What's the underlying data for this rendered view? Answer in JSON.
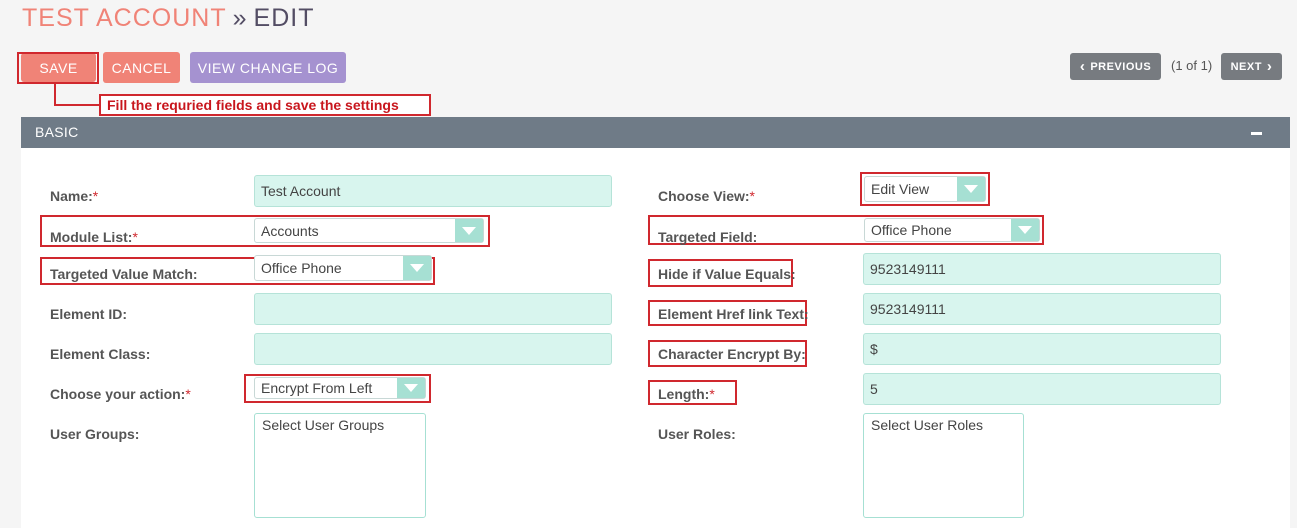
{
  "title": {
    "module": "TEST ACCOUNT",
    "separator": "»",
    "action": "EDIT"
  },
  "buttons": {
    "save": "SAVE",
    "cancel": "CANCEL",
    "view_change_log": "VIEW CHANGE LOG"
  },
  "pagination": {
    "previous": "PREVIOUS",
    "count": "(1 of 1)",
    "next": "NEXT",
    "prev_icon": "‹",
    "next_icon": "›"
  },
  "annotation": "Fill the requried fields and save the settings",
  "panel": {
    "title": "BASIC"
  },
  "required_marker": "*",
  "fields": {
    "name": {
      "label": "Name:",
      "value": "Test Account"
    },
    "module_list": {
      "label": "Module List:",
      "value": "Accounts"
    },
    "targeted_value_match": {
      "label": "Targeted Value Match:",
      "value": "Office Phone"
    },
    "element_id": {
      "label": "Element ID:",
      "value": ""
    },
    "element_class": {
      "label": "Element Class:",
      "value": ""
    },
    "choose_action": {
      "label": "Choose your action:",
      "value": "Encrypt From Left"
    },
    "user_groups": {
      "label": "User Groups:",
      "placeholder": "Select User Groups"
    },
    "choose_view": {
      "label": "Choose View:",
      "value": "Edit View"
    },
    "targeted_field": {
      "label": "Targeted Field:",
      "value": "Office Phone"
    },
    "hide_if_value_equals": {
      "label": "Hide if Value Equals:",
      "value": "9523149111"
    },
    "element_href_link_text": {
      "label": "Element Href link Text:",
      "value": "9523149111"
    },
    "character_encrypt_by": {
      "label": "Character Encrypt By:",
      "value": "$"
    },
    "length": {
      "label": "Length:",
      "value": "5"
    },
    "user_roles": {
      "label": "User Roles:",
      "placeholder": "Select User Roles"
    }
  },
  "colors": {
    "accent": "#f08377",
    "purple": "#a592d0",
    "panel_header": "#6f7b87",
    "input_bg": "#d8f5ee",
    "dropdown_arrow": "#a6e0d3",
    "annotation_red": "#d0282e"
  }
}
